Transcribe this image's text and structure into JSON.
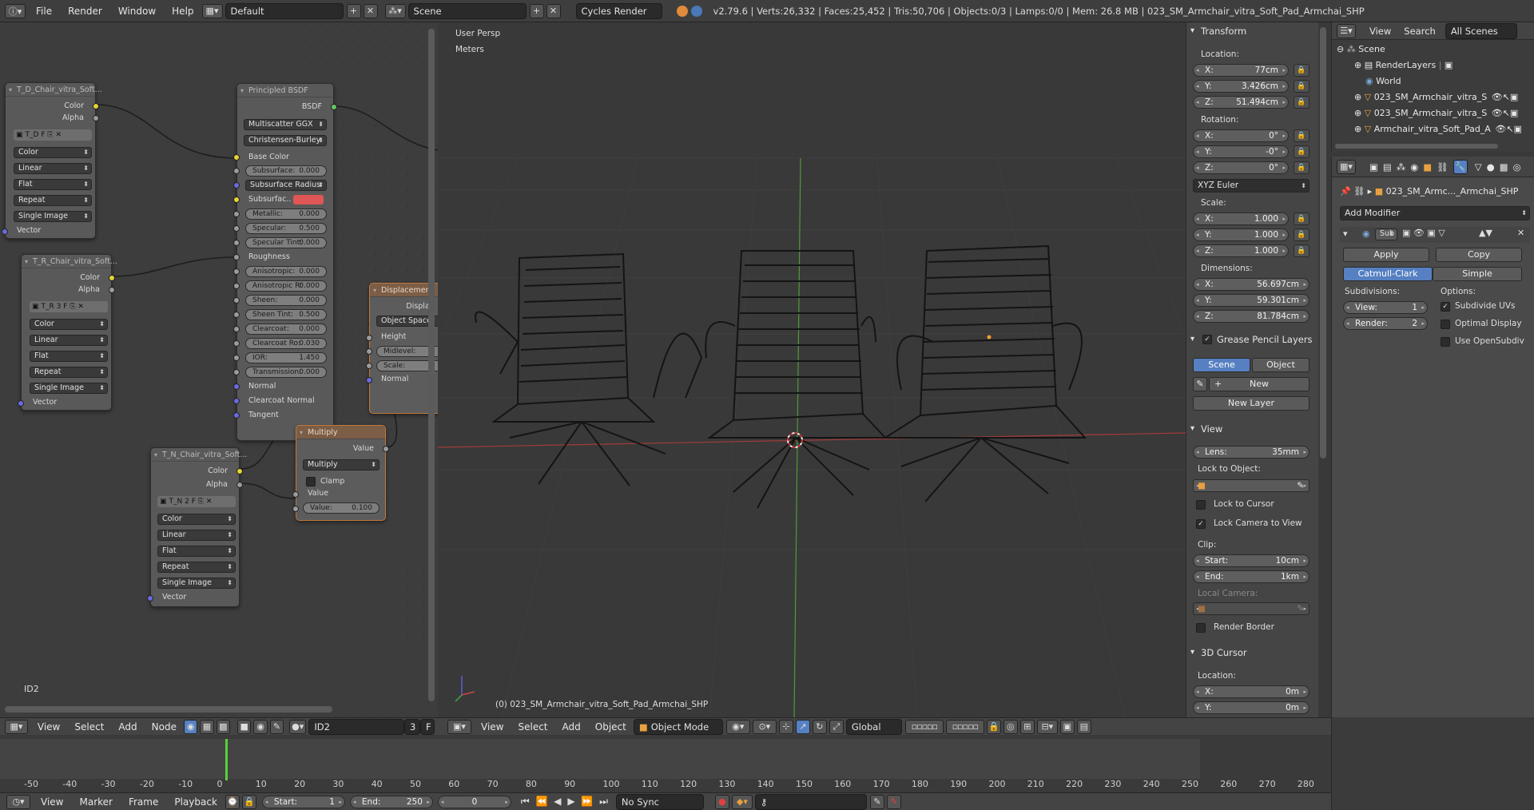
{
  "topbar": {
    "menus": [
      "File",
      "Render",
      "Window",
      "Help"
    ],
    "layout": "Default",
    "scene": "Scene",
    "engine": "Cycles Render",
    "stats": "v2.79.6 | Verts:26,332 | Faces:25,452 | Tris:50,706 | Objects:0/3 | Lamps:0/0 | Mem: 26.8 MB | 023_SM_Armchair_vitra_Soft_Pad_Armchai_SHP"
  },
  "nodes": {
    "tex_d": {
      "title": "T_D_Chair_vitra_Soft...",
      "color": "Color",
      "alpha": "Alpha",
      "img": "T_D",
      "f": "F",
      "interp": "Color",
      "ext": "Linear",
      "proj": "Flat",
      "repeat": "Repeat",
      "source": "Single Image",
      "vector": "Vector"
    },
    "tex_r": {
      "title": "T_R_Chair_vitra_Soft...",
      "color": "Color",
      "alpha": "Alpha",
      "img": "T_R",
      "num": "3",
      "f": "F",
      "interp": "Color",
      "ext": "Linear",
      "proj": "Flat",
      "repeat": "Repeat",
      "source": "Single Image",
      "vector": "Vector"
    },
    "tex_n": {
      "title": "T_N_Chair_vitra_Soft...",
      "color": "Color",
      "alpha": "Alpha",
      "img": "T_N",
      "num": "2",
      "f": "F",
      "interp": "Color",
      "ext": "Linear",
      "proj": "Flat",
      "repeat": "Repeat",
      "source": "Single Image",
      "vector": "Vector"
    },
    "bsdf": {
      "title": "Principled BSDF",
      "out": "BSDF",
      "dist": "Multiscatter GGX",
      "sss": "Christensen-Burley",
      "base": "Base Color",
      "rows": [
        [
          "Subsurface:",
          "0.000"
        ],
        [
          "Subsurface Radius",
          ""
        ],
        [
          "Subsurfac..",
          ""
        ],
        [
          "Metallic:",
          "0.000"
        ],
        [
          "Specular:",
          "0.500"
        ],
        [
          "Specular Tint:",
          "0.000"
        ],
        [
          "Roughness",
          ""
        ],
        [
          "Anisotropic:",
          "0.000"
        ],
        [
          "Anisotropic R:",
          "0.000"
        ],
        [
          "Sheen:",
          "0.000"
        ],
        [
          "Sheen Tint:",
          "0.500"
        ],
        [
          "Clearcoat:",
          "0.000"
        ],
        [
          "Clearcoat Ro:",
          "0.030"
        ],
        [
          "IOR:",
          "1.450"
        ],
        [
          "Transmission:",
          "0.000"
        ],
        [
          "Normal",
          ""
        ],
        [
          "Clearcoat Normal",
          ""
        ],
        [
          "Tangent",
          ""
        ]
      ],
      "sss_color": "#e05555"
    },
    "disp": {
      "title": "Displacemen",
      "out": "Displac",
      "space": "Object Space",
      "height": "Height",
      "midlevel": "Midlevel:",
      "scale": "Scale:",
      "normal": "Normal"
    },
    "mult": {
      "title": "Multiply",
      "value_out": "Value",
      "op": "Multiply",
      "clamp": "Clamp",
      "value_in": "Value",
      "value_field": "Value:",
      "value_num": "0.100"
    },
    "frame_label": "ID2"
  },
  "node_header": {
    "menus": [
      "View",
      "Select",
      "Add",
      "Node"
    ],
    "material": "ID2",
    "users": "3",
    "f": "F"
  },
  "viewport": {
    "view_name": "User Persp",
    "units": "Meters",
    "object_label": "(0) 023_SM_Armchair_vitra_Soft_Pad_Armchai_SHP"
  },
  "view_header": {
    "menus": [
      "View",
      "Select",
      "Add",
      "Object"
    ],
    "mode": "Object Mode",
    "orientation": "Global"
  },
  "npanel": {
    "transform": "Transform",
    "location": "Location:",
    "rotation": "Rotation:",
    "scale": "Scale:",
    "dimensions": "Dimensions:",
    "loc": [
      "77cm",
      "3.426cm",
      "51.494cm"
    ],
    "rot": [
      "0°",
      "-0°",
      "0°"
    ],
    "euler": "XYZ Euler",
    "scl": [
      "1.000",
      "1.000",
      "1.000"
    ],
    "dim": [
      "56.697cm",
      "59.301cm",
      "81.784cm"
    ],
    "axes": [
      "X:",
      "Y:",
      "Z:"
    ],
    "gp": "Grease Pencil Layers",
    "gp_scene": "Scene",
    "gp_object": "Object",
    "gp_new": "New",
    "gp_new_layer": "New Layer",
    "view": "View",
    "lens_label": "Lens:",
    "lens": "35mm",
    "lock_obj": "Lock to Object:",
    "lock_cursor": "Lock to Cursor",
    "lock_cam": "Lock Camera to View",
    "clip": "Clip:",
    "start_label": "Start:",
    "start": "10cm",
    "end_label": "End:",
    "end": "1km",
    "local_cam": "Local Camera:",
    "render_border": "Render Border",
    "cursor": "3D Cursor",
    "cur_loc": "Location:",
    "cur": [
      "0m",
      "0m"
    ]
  },
  "outliner": {
    "menus": [
      "View",
      "Search"
    ],
    "filter": "All Scenes",
    "items": [
      "Scene",
      "RenderLayers",
      "World",
      "023_SM_Armchair_vitra_S",
      "023_SM_Armchair_vitra_S",
      "Armchair_vitra_Soft_Pad_A"
    ]
  },
  "properties": {
    "object": "023_SM_Armc..._Armchai_SHP",
    "add_modifier": "Add Modifier",
    "mod_name": "Sub",
    "apply": "Apply",
    "copy": "Copy",
    "catmull": "Catmull-Clark",
    "simple": "Simple",
    "subdivisions": "Subdivisions:",
    "options": "Options:",
    "view_label": "View:",
    "view_val": "1",
    "render_label": "Render:",
    "render_val": "2",
    "subdiv_uvs": "Subdivide UVs",
    "optimal": "Optimal Display",
    "opensubdiv": "Use OpenSubdiv"
  },
  "timeline": {
    "ticks": [
      "-50",
      "-40",
      "-30",
      "-20",
      "-10",
      "0",
      "10",
      "20",
      "30",
      "40",
      "50",
      "60",
      "70",
      "80",
      "90",
      "100",
      "110",
      "120",
      "130",
      "140",
      "150",
      "160",
      "170",
      "180",
      "190",
      "200",
      "210",
      "220",
      "230",
      "240",
      "250",
      "260",
      "270",
      "280"
    ],
    "menus": [
      "View",
      "Marker",
      "Frame",
      "Playback"
    ],
    "start_label": "Start:",
    "start": "1",
    "end_label": "End:",
    "end": "250",
    "current": "0",
    "sync": "No Sync"
  },
  "colors": {
    "accent": "#5680c2",
    "sss": "#e05555",
    "x_axis": "#a33a3a",
    "y_axis": "#4f9a3a"
  }
}
